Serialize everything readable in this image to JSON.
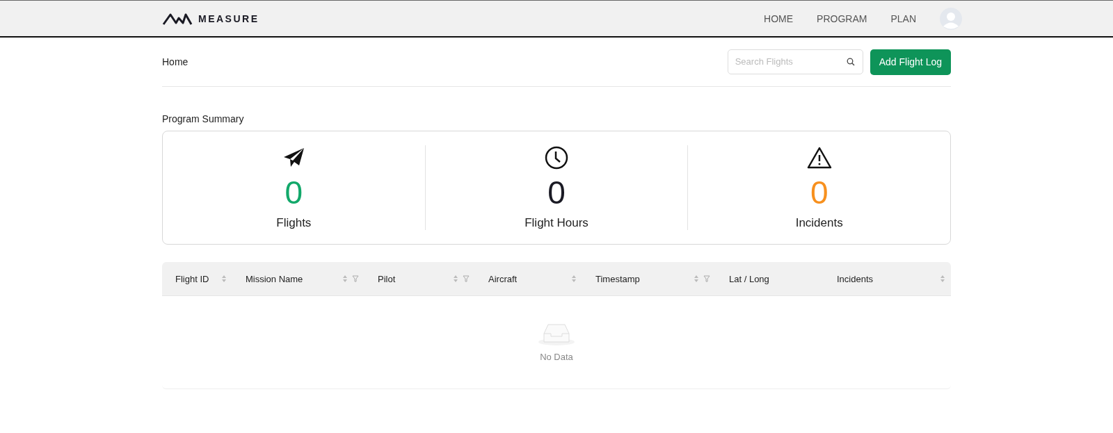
{
  "header": {
    "logo_text": "MEASURE",
    "nav": [
      {
        "label": "HOME"
      },
      {
        "label": "PROGRAM"
      },
      {
        "label": "PLAN"
      }
    ]
  },
  "breadcrumb": "Home",
  "search": {
    "placeholder": "Search Flights"
  },
  "add_button": "Add Flight Log",
  "summary": {
    "title": "Program Summary",
    "stats": [
      {
        "kind": "plane",
        "value": "0",
        "label": "Flights",
        "color": "#12a86a"
      },
      {
        "kind": "clock",
        "value": "0",
        "label": "Flight Hours",
        "color": "#1a1a24"
      },
      {
        "kind": "warning",
        "value": "0",
        "label": "Incidents",
        "color": "#f7901e"
      }
    ]
  },
  "table": {
    "columns": [
      {
        "label": "Flight ID",
        "sortable": true,
        "filterable": false
      },
      {
        "label": "Mission Name",
        "sortable": true,
        "filterable": true
      },
      {
        "label": "Pilot",
        "sortable": true,
        "filterable": true
      },
      {
        "label": "Aircraft",
        "sortable": true,
        "filterable": false
      },
      {
        "label": "Timestamp",
        "sortable": true,
        "filterable": true
      },
      {
        "label": "Lat / Long",
        "sortable": false,
        "filterable": false
      },
      {
        "label": "Incidents",
        "sortable": true,
        "filterable": false
      }
    ],
    "empty_text": "No Data"
  }
}
